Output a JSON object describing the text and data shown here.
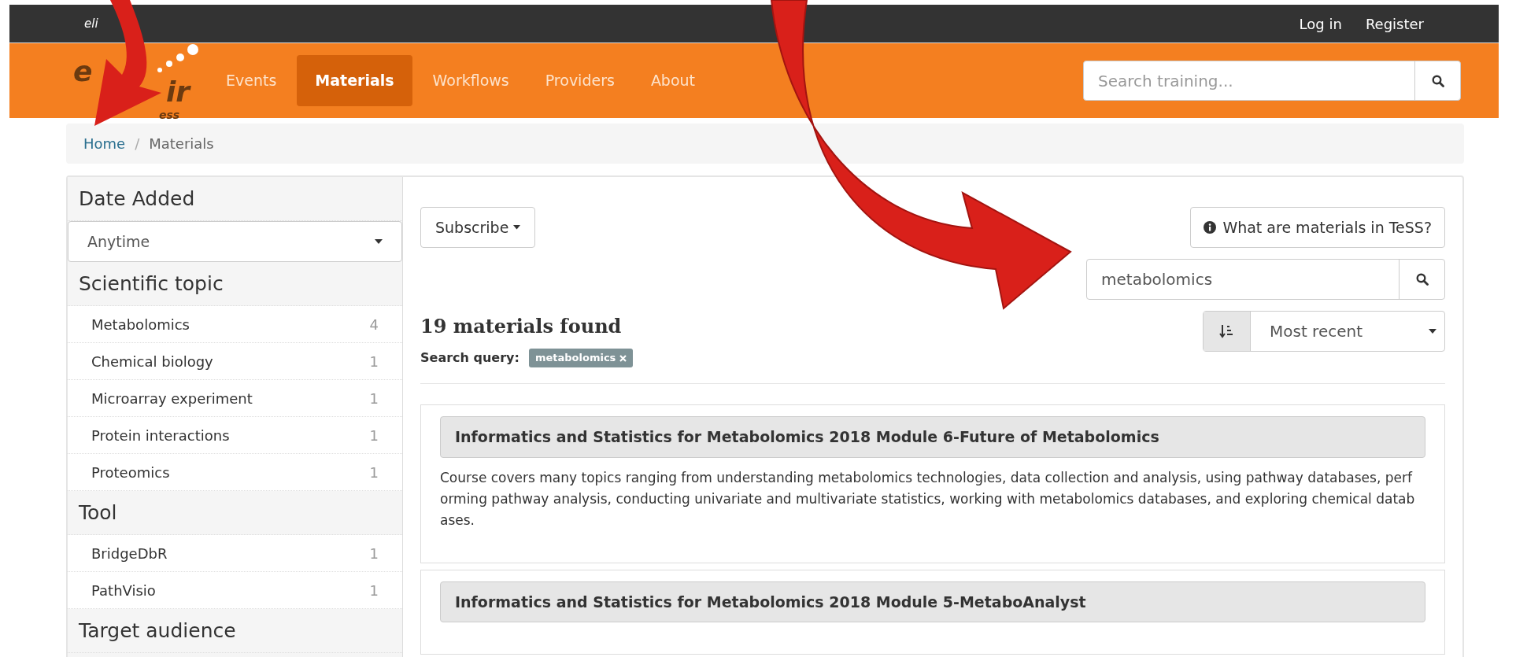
{
  "top_bar": {
    "logo_text": "eli",
    "links": [
      "Log in",
      "Register"
    ]
  },
  "navbar": {
    "logo": {
      "main_left": "e",
      "main_right": "ir",
      "sub": "ess"
    },
    "tabs": [
      {
        "label": "Events",
        "selected": false
      },
      {
        "label": "Materials",
        "selected": true
      },
      {
        "label": "Workflows",
        "selected": false
      },
      {
        "label": "Providers",
        "selected": false
      },
      {
        "label": "About",
        "selected": false
      }
    ],
    "search": {
      "placeholder": "Search training..."
    }
  },
  "breadcrumb": {
    "separator": "/",
    "items": [
      {
        "label": "Home",
        "kind": "link"
      },
      {
        "label": "Materials",
        "kind": "current"
      }
    ]
  },
  "sidebar": {
    "sections": [
      {
        "heading": "Date Added",
        "kind": "select",
        "value": "Anytime"
      },
      {
        "heading": "Scientific topic",
        "kind": "list",
        "items": [
          {
            "label": "Metabolomics",
            "count": "4"
          },
          {
            "label": "Chemical biology",
            "count": "1"
          },
          {
            "label": "Microarray experiment",
            "count": "1"
          },
          {
            "label": "Protein interactions",
            "count": "1"
          },
          {
            "label": "Proteomics",
            "count": "1"
          }
        ]
      },
      {
        "heading": "Tool",
        "kind": "list",
        "items": [
          {
            "label": "BridgeDbR",
            "count": "1"
          },
          {
            "label": "PathVisio",
            "count": "1"
          }
        ]
      },
      {
        "heading": "Target audience",
        "kind": "heading"
      }
    ]
  },
  "main": {
    "subscribe_button": "Subscribe",
    "info_button": "What are materials in TeSS?",
    "search": {
      "value": "metabolomics"
    },
    "sort": {
      "value": "Most recent"
    },
    "results_count": "19 materials found",
    "query_label": "Search query:",
    "query_tag": "metabolomics",
    "results": [
      {
        "title": "Informatics and Statistics for Metabolomics 2018 Module 6-Future of Metabolomics",
        "description": "Course covers many topics ranging from understanding metabolomics technologies, data collection and analysis, using pathway databases, performing pathway analysis, conducting univariate and multivariate statistics, working with metabolomics databases, and exploring chemical databases."
      },
      {
        "title": "Informatics and Statistics for Metabolomics 2018 Module 5-MetaboAnalyst"
      }
    ]
  }
}
